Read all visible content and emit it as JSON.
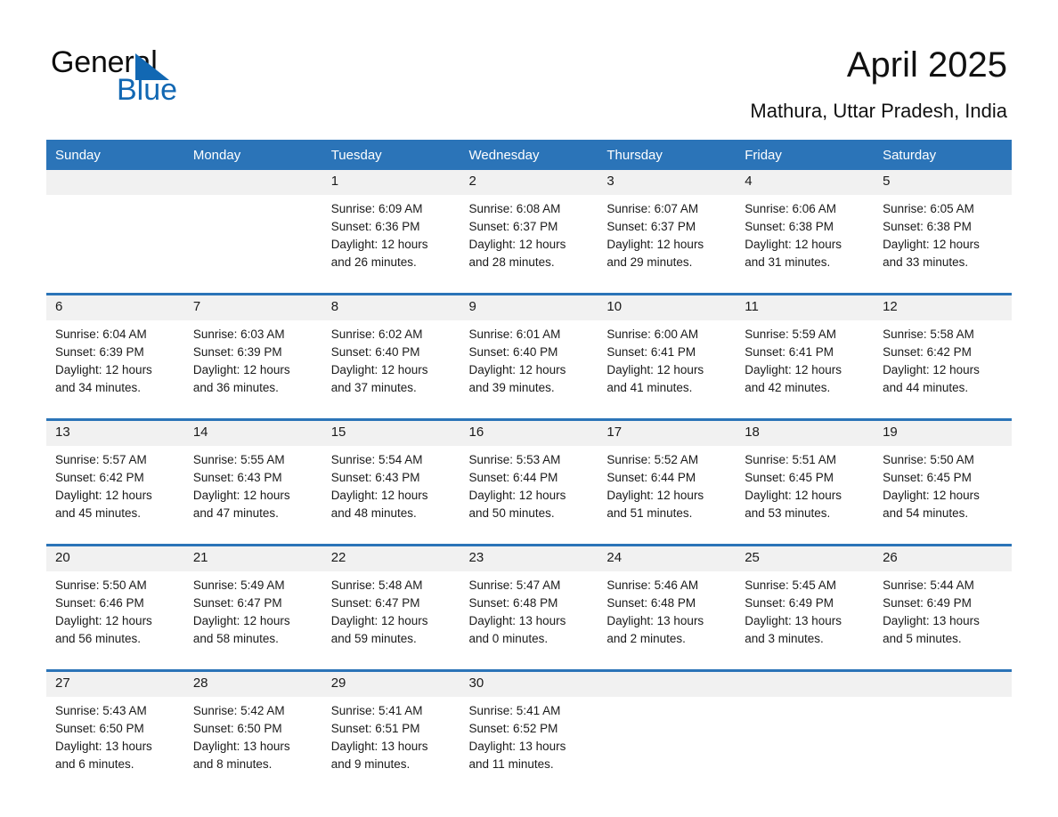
{
  "brand": {
    "name_part1": "General",
    "name_part2": "Blue",
    "triangle_color": "#1268b3",
    "accent_color": "#2b74b8"
  },
  "header": {
    "title": "April 2025",
    "subtitle": "Mathura, Uttar Pradesh, India"
  },
  "calendar": {
    "weekday_headers": [
      "Sunday",
      "Monday",
      "Tuesday",
      "Wednesday",
      "Thursday",
      "Friday",
      "Saturday"
    ],
    "weeks": [
      {
        "days": [
          {
            "number": "",
            "sunrise": "",
            "sunset": "",
            "daylight_line1": "",
            "daylight_line2": ""
          },
          {
            "number": "",
            "sunrise": "",
            "sunset": "",
            "daylight_line1": "",
            "daylight_line2": ""
          },
          {
            "number": "1",
            "sunrise": "Sunrise: 6:09 AM",
            "sunset": "Sunset: 6:36 PM",
            "daylight_line1": "Daylight: 12 hours",
            "daylight_line2": "and 26 minutes."
          },
          {
            "number": "2",
            "sunrise": "Sunrise: 6:08 AM",
            "sunset": "Sunset: 6:37 PM",
            "daylight_line1": "Daylight: 12 hours",
            "daylight_line2": "and 28 minutes."
          },
          {
            "number": "3",
            "sunrise": "Sunrise: 6:07 AM",
            "sunset": "Sunset: 6:37 PM",
            "daylight_line1": "Daylight: 12 hours",
            "daylight_line2": "and 29 minutes."
          },
          {
            "number": "4",
            "sunrise": "Sunrise: 6:06 AM",
            "sunset": "Sunset: 6:38 PM",
            "daylight_line1": "Daylight: 12 hours",
            "daylight_line2": "and 31 minutes."
          },
          {
            "number": "5",
            "sunrise": "Sunrise: 6:05 AM",
            "sunset": "Sunset: 6:38 PM",
            "daylight_line1": "Daylight: 12 hours",
            "daylight_line2": "and 33 minutes."
          }
        ]
      },
      {
        "days": [
          {
            "number": "6",
            "sunrise": "Sunrise: 6:04 AM",
            "sunset": "Sunset: 6:39 PM",
            "daylight_line1": "Daylight: 12 hours",
            "daylight_line2": "and 34 minutes."
          },
          {
            "number": "7",
            "sunrise": "Sunrise: 6:03 AM",
            "sunset": "Sunset: 6:39 PM",
            "daylight_line1": "Daylight: 12 hours",
            "daylight_line2": "and 36 minutes."
          },
          {
            "number": "8",
            "sunrise": "Sunrise: 6:02 AM",
            "sunset": "Sunset: 6:40 PM",
            "daylight_line1": "Daylight: 12 hours",
            "daylight_line2": "and 37 minutes."
          },
          {
            "number": "9",
            "sunrise": "Sunrise: 6:01 AM",
            "sunset": "Sunset: 6:40 PM",
            "daylight_line1": "Daylight: 12 hours",
            "daylight_line2": "and 39 minutes."
          },
          {
            "number": "10",
            "sunrise": "Sunrise: 6:00 AM",
            "sunset": "Sunset: 6:41 PM",
            "daylight_line1": "Daylight: 12 hours",
            "daylight_line2": "and 41 minutes."
          },
          {
            "number": "11",
            "sunrise": "Sunrise: 5:59 AM",
            "sunset": "Sunset: 6:41 PM",
            "daylight_line1": "Daylight: 12 hours",
            "daylight_line2": "and 42 minutes."
          },
          {
            "number": "12",
            "sunrise": "Sunrise: 5:58 AM",
            "sunset": "Sunset: 6:42 PM",
            "daylight_line1": "Daylight: 12 hours",
            "daylight_line2": "and 44 minutes."
          }
        ]
      },
      {
        "days": [
          {
            "number": "13",
            "sunrise": "Sunrise: 5:57 AM",
            "sunset": "Sunset: 6:42 PM",
            "daylight_line1": "Daylight: 12 hours",
            "daylight_line2": "and 45 minutes."
          },
          {
            "number": "14",
            "sunrise": "Sunrise: 5:55 AM",
            "sunset": "Sunset: 6:43 PM",
            "daylight_line1": "Daylight: 12 hours",
            "daylight_line2": "and 47 minutes."
          },
          {
            "number": "15",
            "sunrise": "Sunrise: 5:54 AM",
            "sunset": "Sunset: 6:43 PM",
            "daylight_line1": "Daylight: 12 hours",
            "daylight_line2": "and 48 minutes."
          },
          {
            "number": "16",
            "sunrise": "Sunrise: 5:53 AM",
            "sunset": "Sunset: 6:44 PM",
            "daylight_line1": "Daylight: 12 hours",
            "daylight_line2": "and 50 minutes."
          },
          {
            "number": "17",
            "sunrise": "Sunrise: 5:52 AM",
            "sunset": "Sunset: 6:44 PM",
            "daylight_line1": "Daylight: 12 hours",
            "daylight_line2": "and 51 minutes."
          },
          {
            "number": "18",
            "sunrise": "Sunrise: 5:51 AM",
            "sunset": "Sunset: 6:45 PM",
            "daylight_line1": "Daylight: 12 hours",
            "daylight_line2": "and 53 minutes."
          },
          {
            "number": "19",
            "sunrise": "Sunrise: 5:50 AM",
            "sunset": "Sunset: 6:45 PM",
            "daylight_line1": "Daylight: 12 hours",
            "daylight_line2": "and 54 minutes."
          }
        ]
      },
      {
        "days": [
          {
            "number": "20",
            "sunrise": "Sunrise: 5:50 AM",
            "sunset": "Sunset: 6:46 PM",
            "daylight_line1": "Daylight: 12 hours",
            "daylight_line2": "and 56 minutes."
          },
          {
            "number": "21",
            "sunrise": "Sunrise: 5:49 AM",
            "sunset": "Sunset: 6:47 PM",
            "daylight_line1": "Daylight: 12 hours",
            "daylight_line2": "and 58 minutes."
          },
          {
            "number": "22",
            "sunrise": "Sunrise: 5:48 AM",
            "sunset": "Sunset: 6:47 PM",
            "daylight_line1": "Daylight: 12 hours",
            "daylight_line2": "and 59 minutes."
          },
          {
            "number": "23",
            "sunrise": "Sunrise: 5:47 AM",
            "sunset": "Sunset: 6:48 PM",
            "daylight_line1": "Daylight: 13 hours",
            "daylight_line2": "and 0 minutes."
          },
          {
            "number": "24",
            "sunrise": "Sunrise: 5:46 AM",
            "sunset": "Sunset: 6:48 PM",
            "daylight_line1": "Daylight: 13 hours",
            "daylight_line2": "and 2 minutes."
          },
          {
            "number": "25",
            "sunrise": "Sunrise: 5:45 AM",
            "sunset": "Sunset: 6:49 PM",
            "daylight_line1": "Daylight: 13 hours",
            "daylight_line2": "and 3 minutes."
          },
          {
            "number": "26",
            "sunrise": "Sunrise: 5:44 AM",
            "sunset": "Sunset: 6:49 PM",
            "daylight_line1": "Daylight: 13 hours",
            "daylight_line2": "and 5 minutes."
          }
        ]
      },
      {
        "days": [
          {
            "number": "27",
            "sunrise": "Sunrise: 5:43 AM",
            "sunset": "Sunset: 6:50 PM",
            "daylight_line1": "Daylight: 13 hours",
            "daylight_line2": "and 6 minutes."
          },
          {
            "number": "28",
            "sunrise": "Sunrise: 5:42 AM",
            "sunset": "Sunset: 6:50 PM",
            "daylight_line1": "Daylight: 13 hours",
            "daylight_line2": "and 8 minutes."
          },
          {
            "number": "29",
            "sunrise": "Sunrise: 5:41 AM",
            "sunset": "Sunset: 6:51 PM",
            "daylight_line1": "Daylight: 13 hours",
            "daylight_line2": "and 9 minutes."
          },
          {
            "number": "30",
            "sunrise": "Sunrise: 5:41 AM",
            "sunset": "Sunset: 6:52 PM",
            "daylight_line1": "Daylight: 13 hours",
            "daylight_line2": "and 11 minutes."
          },
          {
            "number": "",
            "sunrise": "",
            "sunset": "",
            "daylight_line1": "",
            "daylight_line2": ""
          },
          {
            "number": "",
            "sunrise": "",
            "sunset": "",
            "daylight_line1": "",
            "daylight_line2": ""
          },
          {
            "number": "",
            "sunrise": "",
            "sunset": "",
            "daylight_line1": "",
            "daylight_line2": ""
          }
        ]
      }
    ]
  }
}
